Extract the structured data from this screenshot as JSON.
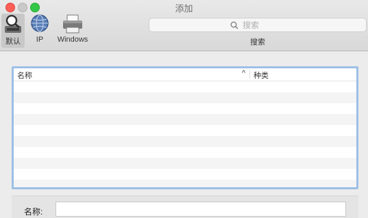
{
  "window": {
    "title": "添加"
  },
  "toolbar": {
    "items": [
      {
        "label": "默认",
        "icon": "magnifier-printer-icon",
        "selected": true
      },
      {
        "label": "IP",
        "icon": "globe-icon",
        "selected": false
      },
      {
        "label": "Windows",
        "icon": "printer-icon",
        "selected": false
      }
    ],
    "search": {
      "placeholder": "搜索",
      "caption": "搜索"
    }
  },
  "list": {
    "columns": [
      "名称",
      "种类"
    ],
    "sort_indicator": "^",
    "rows": []
  },
  "form": {
    "name_label": "名称:",
    "name_value": ""
  },
  "colors": {
    "close": "#fd5f57",
    "maximize": "#33c748",
    "list_border": "#9cbfe6"
  }
}
